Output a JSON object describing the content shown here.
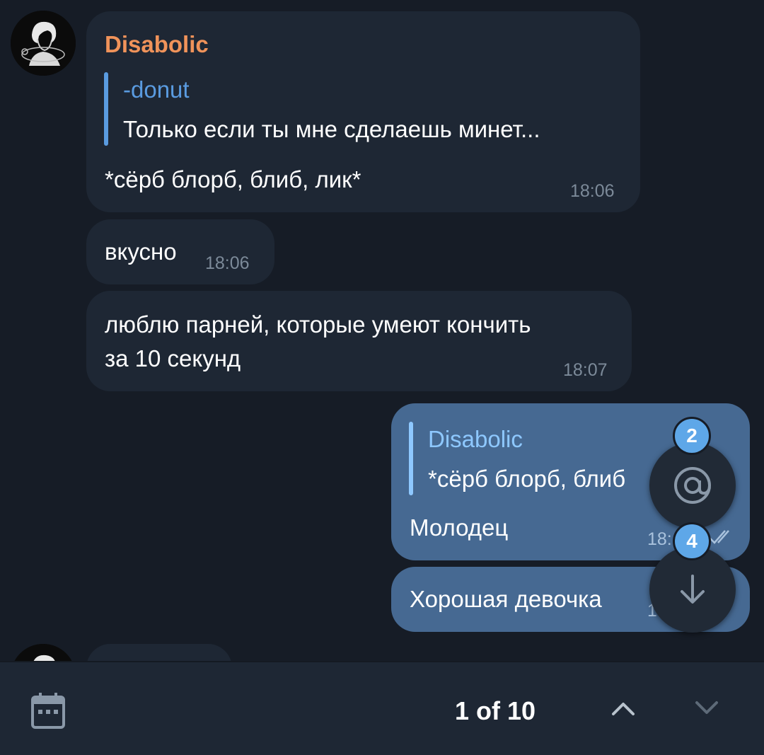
{
  "messages": {
    "m1": {
      "sender": "Disabolic",
      "reply_name": "-donut",
      "reply_text": "Только если ты мне сделаешь минет...",
      "text": "*сёрб блорб, блиб, лик*",
      "time": "18:06"
    },
    "m2": {
      "text": "вкусно",
      "time": "18:06"
    },
    "m3": {
      "line1": "люблю парней, которые умеют кончить",
      "line2": "за 10 секунд",
      "time": "18:07"
    },
    "m4": {
      "reply_name": "Disabolic",
      "reply_text": "*сёрб блорб, блиб",
      "text": "Молодец",
      "time": "18:"
    },
    "m5": {
      "text": "Хорошая девочка",
      "time": "1"
    }
  },
  "fabs": {
    "mentions_count": "2",
    "unread_count": "4"
  },
  "search_bar": {
    "counter": "1 of 10"
  },
  "colors": {
    "background": "#161c26",
    "incoming_bubble": "#1e2734",
    "outgoing_bubble": "#466992",
    "sender_name": "#f0935a",
    "reply_accent_in": "#5a9be0",
    "reply_accent_out": "#8ec8ff",
    "badge": "#5ea7e8"
  },
  "icons": [
    "avatar",
    "double-check-icon",
    "mention-icon",
    "arrow-down-icon",
    "calendar-icon",
    "chevron-up-icon",
    "chevron-down-icon"
  ]
}
